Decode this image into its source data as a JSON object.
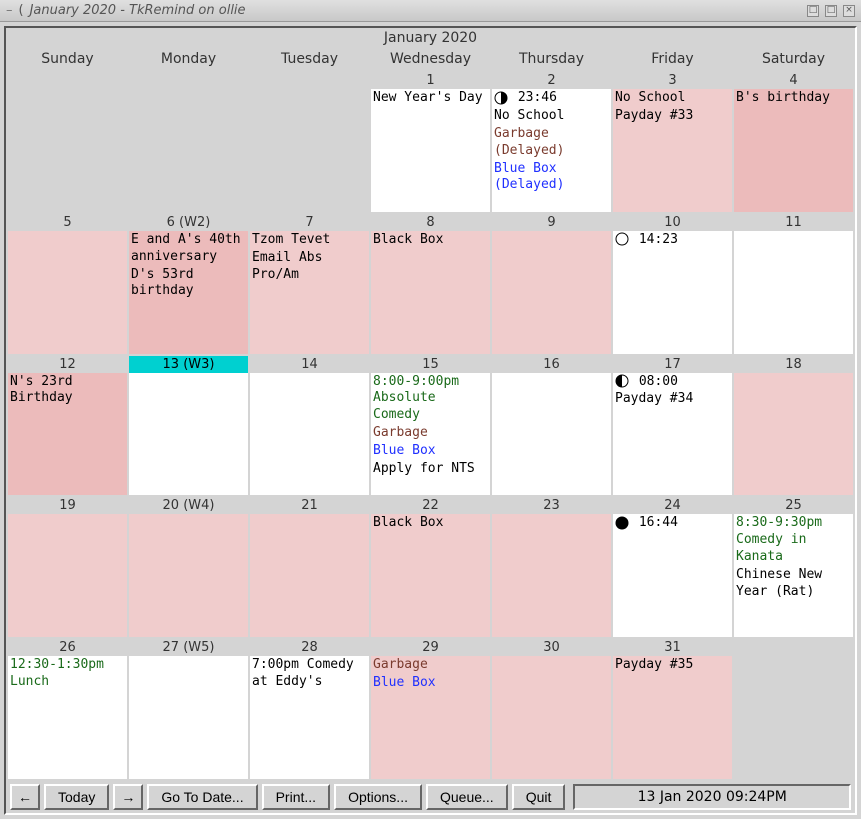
{
  "window": {
    "dash": "–",
    "title": "January 2020 - TkRemind on ollie",
    "minimize_glyph": "□",
    "maximize_glyph": "□",
    "close_glyph": "×"
  },
  "month_title": "January 2020",
  "day_headers": [
    "Sunday",
    "Monday",
    "Tuesday",
    "Wednesday",
    "Thursday",
    "Friday",
    "Saturday"
  ],
  "toolbar": {
    "prev_glyph": "←",
    "today": "Today",
    "next_glyph": "→",
    "goto": "Go To Date...",
    "print": "Print...",
    "options": "Options...",
    "queue": "Queue...",
    "quit": "Quit",
    "status": "13 Jan 2020 09:24PM"
  },
  "cells": [
    {
      "label": "",
      "body_class": "empty",
      "today": false,
      "events": []
    },
    {
      "label": "",
      "body_class": "empty",
      "today": false,
      "events": []
    },
    {
      "label": "",
      "body_class": "empty",
      "today": false,
      "events": []
    },
    {
      "label": "1",
      "body_class": "white",
      "today": false,
      "events": [
        {
          "text": "New Year's Day",
          "color": "c-black"
        }
      ]
    },
    {
      "label": "2",
      "body_class": "white",
      "today": false,
      "events": [
        {
          "moon": "first",
          "text": "23:46",
          "color": "c-black"
        },
        {
          "text": "No School",
          "color": "c-black"
        },
        {
          "text": "Garbage (Delayed)",
          "color": "c-brown"
        },
        {
          "text": "Blue Box (Delayed)",
          "color": "c-blue"
        }
      ]
    },
    {
      "label": "3",
      "body_class": "pink",
      "today": false,
      "events": [
        {
          "text": "No School",
          "color": "c-black"
        },
        {
          "text": "Payday #33",
          "color": "c-black"
        }
      ]
    },
    {
      "label": "4",
      "body_class": "pink2",
      "today": false,
      "events": [
        {
          "text": "B's birthday",
          "color": "c-black"
        }
      ]
    },
    {
      "label": "5",
      "body_class": "pink",
      "today": false,
      "events": []
    },
    {
      "label": "6 (W2)",
      "body_class": "pink2",
      "today": false,
      "events": [
        {
          "text": "E and A's 40th anniversary",
          "color": "c-black"
        },
        {
          "text": "D's 53rd birthday",
          "color": "c-black"
        }
      ]
    },
    {
      "label": "7",
      "body_class": "pink",
      "today": false,
      "events": [
        {
          "text": "Tzom Tevet",
          "color": "c-black"
        },
        {
          "text": "Email Abs Pro/Am",
          "color": "c-black"
        }
      ]
    },
    {
      "label": "8",
      "body_class": "pink",
      "today": false,
      "events": [
        {
          "text": "Black Box",
          "color": "c-black"
        }
      ]
    },
    {
      "label": "9",
      "body_class": "pink",
      "today": false,
      "events": []
    },
    {
      "label": "10",
      "body_class": "white",
      "today": false,
      "events": [
        {
          "moon": "full",
          "text": "14:23",
          "color": "c-black"
        }
      ]
    },
    {
      "label": "11",
      "body_class": "white",
      "today": false,
      "events": []
    },
    {
      "label": "12",
      "body_class": "pink2",
      "today": false,
      "events": [
        {
          "text": "N's 23rd Birthday",
          "color": "c-black"
        }
      ]
    },
    {
      "label": "13 (W3)",
      "body_class": "white",
      "today": true,
      "events": []
    },
    {
      "label": "14",
      "body_class": "white",
      "today": false,
      "events": []
    },
    {
      "label": "15",
      "body_class": "white",
      "today": false,
      "events": [
        {
          "text": "8:00-9:00pm Absolute Comedy",
          "color": "c-green"
        },
        {
          "text": "Garbage",
          "color": "c-brown"
        },
        {
          "text": "Blue Box",
          "color": "c-blue"
        },
        {
          "text": "Apply for NTS",
          "color": "c-black"
        }
      ]
    },
    {
      "label": "16",
      "body_class": "white",
      "today": false,
      "events": []
    },
    {
      "label": "17",
      "body_class": "white",
      "today": false,
      "events": [
        {
          "moon": "last",
          "text": "08:00",
          "color": "c-black"
        },
        {
          "text": "Payday #34",
          "color": "c-black"
        }
      ]
    },
    {
      "label": "18",
      "body_class": "pink",
      "today": false,
      "events": []
    },
    {
      "label": "19",
      "body_class": "pink",
      "today": false,
      "events": []
    },
    {
      "label": "20 (W4)",
      "body_class": "pink",
      "today": false,
      "events": []
    },
    {
      "label": "21",
      "body_class": "pink",
      "today": false,
      "events": []
    },
    {
      "label": "22",
      "body_class": "pink",
      "today": false,
      "events": [
        {
          "text": "Black Box",
          "color": "c-black"
        }
      ]
    },
    {
      "label": "23",
      "body_class": "pink",
      "today": false,
      "events": []
    },
    {
      "label": "24",
      "body_class": "white",
      "today": false,
      "events": [
        {
          "moon": "new",
          "text": "16:44",
          "color": "c-black"
        }
      ]
    },
    {
      "label": "25",
      "body_class": "white",
      "today": false,
      "events": [
        {
          "text": "8:30-9:30pm Comedy in Kanata",
          "color": "c-green"
        },
        {
          "text": "Chinese New Year (Rat)",
          "color": "c-black"
        }
      ]
    },
    {
      "label": "26",
      "body_class": "white",
      "today": false,
      "events": [
        {
          "text": "12:30-1:30pm Lunch",
          "color": "c-green"
        }
      ]
    },
    {
      "label": "27 (W5)",
      "body_class": "white",
      "today": false,
      "events": []
    },
    {
      "label": "28",
      "body_class": "white",
      "today": false,
      "events": [
        {
          "text": "7:00pm Comedy at Eddy's",
          "color": "c-black"
        }
      ]
    },
    {
      "label": "29",
      "body_class": "pink",
      "today": false,
      "events": [
        {
          "text": "Garbage",
          "color": "c-brown"
        },
        {
          "text": "Blue Box",
          "color": "c-blue"
        }
      ]
    },
    {
      "label": "30",
      "body_class": "pink",
      "today": false,
      "events": []
    },
    {
      "label": "31",
      "body_class": "pink",
      "today": false,
      "events": [
        {
          "text": "Payday #35",
          "color": "c-black"
        }
      ]
    },
    {
      "label": "",
      "body_class": "empty",
      "today": false,
      "events": []
    }
  ]
}
